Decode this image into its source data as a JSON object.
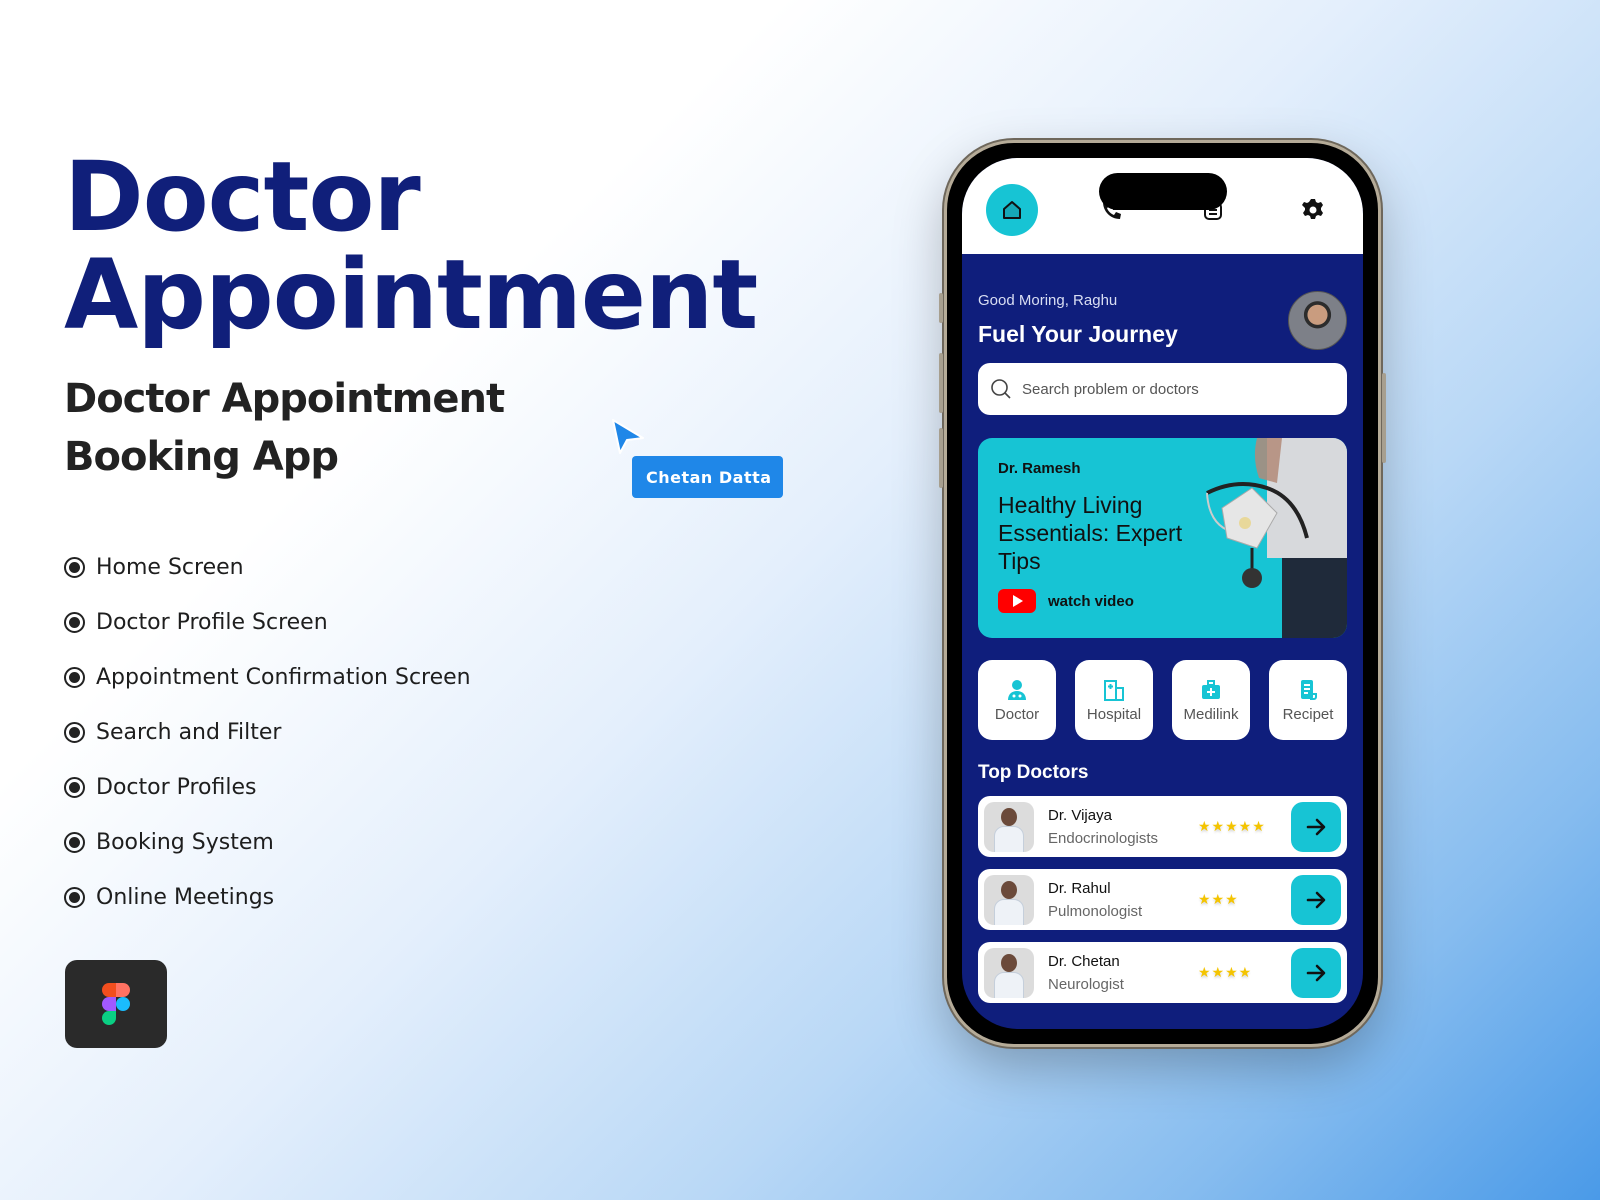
{
  "hero": {
    "title_line1": "Doctor",
    "title_line2": "Appointment",
    "subtitle_line1": "Doctor Appointment",
    "subtitle_line2": "Booking App"
  },
  "features": [
    "Home Screen",
    "Doctor Profile Screen",
    "Appointment Confirmation Screen",
    "Search and Filter",
    "Doctor Profiles",
    "Booking System",
    "Online Meetings"
  ],
  "cursor_tag": {
    "label": "Chetan Datta"
  },
  "colors": {
    "brand_navy": "#101f7a",
    "accent_teal": "#17c4d4",
    "cursor_blue": "#1f87e8",
    "star": "#f4c400"
  },
  "app": {
    "nav": [
      {
        "icon": "home-icon",
        "active": true
      },
      {
        "icon": "call-list-icon",
        "active": false
      },
      {
        "icon": "calendar-icon",
        "active": false
      },
      {
        "icon": "gear-icon",
        "active": false
      }
    ],
    "greeting": "Good Moring, Raghu",
    "headline": "Fuel Your Journey",
    "search_placeholder": "Search problem or doctors",
    "banner": {
      "doctor": "Dr. Ramesh",
      "title": "Healthy Living Essentials: Expert Tips",
      "cta": "watch video"
    },
    "categories": [
      {
        "label": "Doctor",
        "icon": "doctor-icon"
      },
      {
        "label": "Hospital",
        "icon": "hospital-icon"
      },
      {
        "label": "Medilink",
        "icon": "medical-kit-icon"
      },
      {
        "label": "Recipet",
        "icon": "receipt-icon"
      }
    ],
    "top_doctors_title": "Top Doctors",
    "doctors": [
      {
        "name": "Dr. Vijaya",
        "specialty": "Endocrinologists",
        "rating": 5,
        "stars": "★★★★★"
      },
      {
        "name": "Dr. Rahul",
        "specialty": "Pulmonologist",
        "rating": 3,
        "stars": "★★★"
      },
      {
        "name": "Dr. Chetan",
        "specialty": "Neurologist",
        "rating": 4,
        "stars": "★★★★"
      }
    ]
  }
}
